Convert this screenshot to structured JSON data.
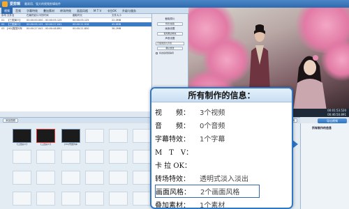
{
  "titlebar": {
    "title": "爱剪辑",
    "slogan": "最易用、强大的视频剪辑软件"
  },
  "menu": {
    "tabs": [
      "视频",
      "音频",
      "字幕特效",
      "叠加素材",
      "转场特效",
      "画面风格",
      "M T V",
      "卡拉OK",
      "升级与服务"
    ],
    "active_index": 0
  },
  "list": {
    "headers": [
      "序号",
      "文件名",
      "在最终影片中的时间",
      "截取时长",
      "文件大小"
    ],
    "rows": [
      {
        "num": "01",
        "name": "【三国演义】",
        "dur": "00:00:00.000 - 00:00:05.125",
        "cut": "00:00:05.125",
        "size": "22.0MB"
      },
      {
        "num": "02",
        "name": "【三国演义】",
        "dur": "00:00:05.125 - 00:00:27.041",
        "cut": "00:00:21.916",
        "size": "45.6MB"
      },
      {
        "num": "03",
        "name": "[HD]雪国列车",
        "dur": "00:00:27.041 - 00:00:48.891",
        "cut": "00:00:21.850",
        "size": "38.2MB"
      }
    ]
  },
  "settings": {
    "group1": "截取原片",
    "btn1": "预览/截取",
    "group2": "画面设置",
    "btn2": "使用黑边填充",
    "group3": "声音设置",
    "select1": "不使用原片声音",
    "btn3": "确认修改",
    "check": "将这段视频静音"
  },
  "player": {
    "current": "00:01:53.520",
    "total": "00:46:50.891"
  },
  "story": {
    "toolbar_btn": "添加视频",
    "zoom_btn": "撤销",
    "thumb_labels": [
      "【三国演义】",
      "【三国演义】",
      "[HD]雪国列车"
    ]
  },
  "export": {
    "label": "导出视频"
  },
  "right_panel": {
    "title": "所有制作的信息"
  },
  "popup": {
    "title": "所有制作的信息：",
    "rows": [
      {
        "label": "视　　频：",
        "value": "3个视频"
      },
      {
        "label": "音　　频：",
        "value": "0个音频"
      },
      {
        "label": "字幕特效：",
        "value": "1个字幕"
      },
      {
        "label": "M　T　V：",
        "value": ""
      },
      {
        "label": "卡 拉 OK：",
        "value": ""
      },
      {
        "label": "转场特效：",
        "value": "透明式淡入淡出"
      },
      {
        "label": "画面风格：",
        "value": "2个画面风格"
      },
      {
        "label": "叠加素材：",
        "value": "1个素材"
      }
    ]
  }
}
